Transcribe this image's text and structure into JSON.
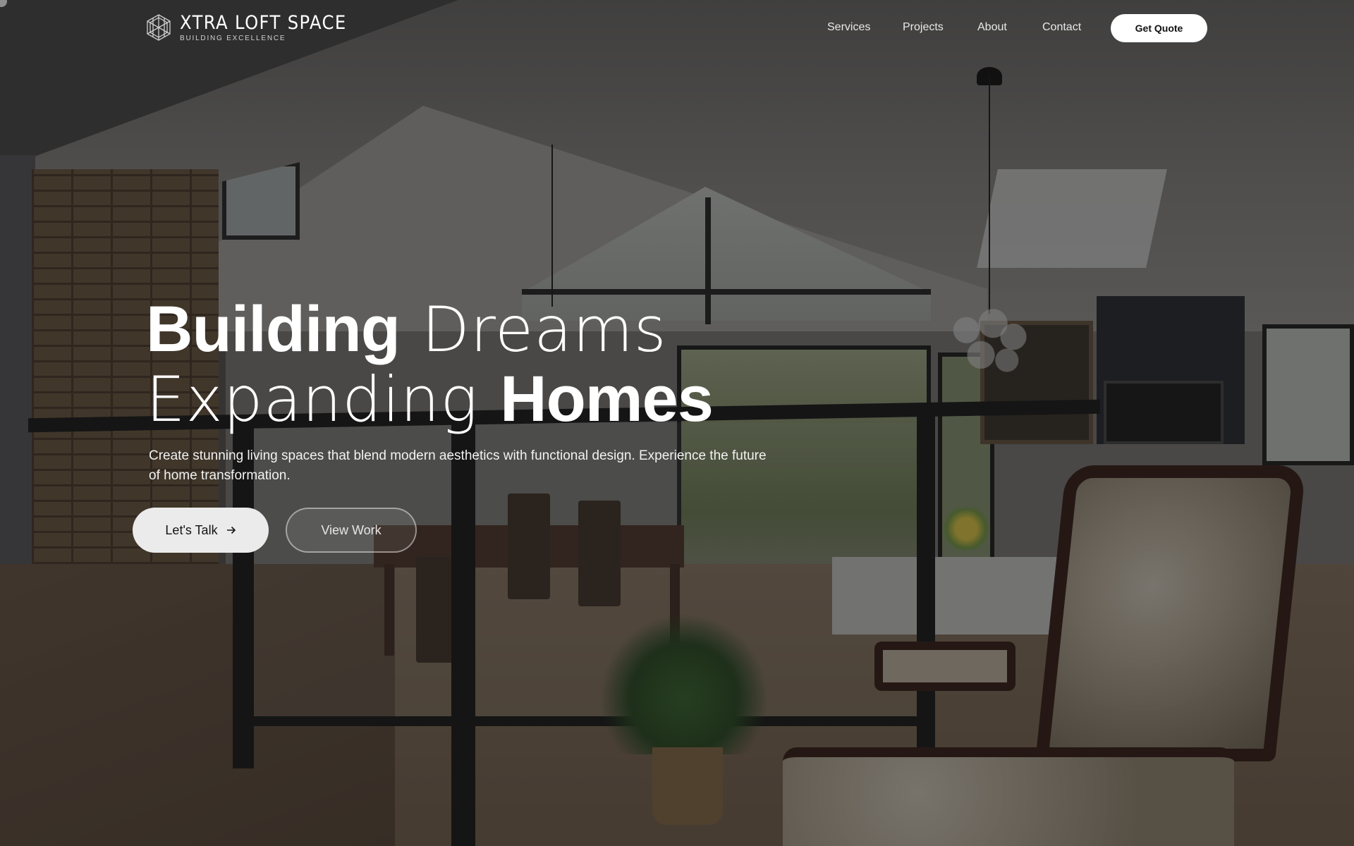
{
  "brand": {
    "name": "XTRA LOFT SPACE",
    "tagline": "BUILDING EXCELLENCE",
    "logo_icon": "cube-wireframe-icon"
  },
  "nav": {
    "links": [
      {
        "label": "Services"
      },
      {
        "label": "Projects"
      },
      {
        "label": "About"
      },
      {
        "label": "Contact"
      }
    ],
    "cta_label": "Get Quote"
  },
  "hero": {
    "line1_bold": "Building",
    "line1_light": "Dreams",
    "line2_light": "Expanding",
    "line2_bold": "Homes",
    "description": "Create stunning living spaces that blend modern aesthetics with functional design. Experience the future of home transformation.",
    "primary_button": "Let's Talk",
    "primary_button_icon": "arrow-right-icon",
    "secondary_button": "View Work",
    "background_image": "loft-interior-photo"
  },
  "colors": {
    "text": "#ffffff",
    "button_primary_bg": "#ebebeb",
    "button_primary_text": "#141414",
    "overlay": "rgba(15,15,15,0.48)"
  }
}
